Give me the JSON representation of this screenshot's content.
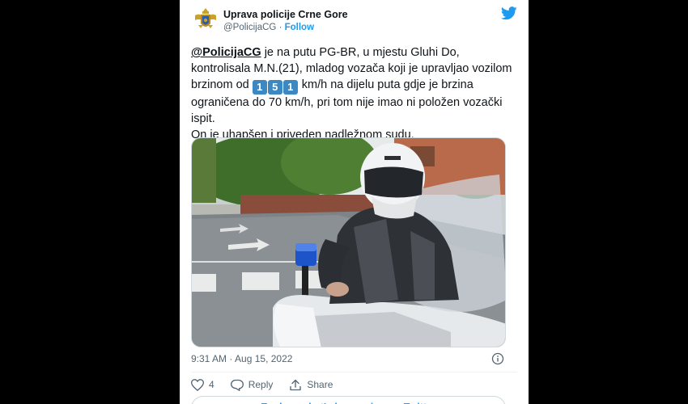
{
  "account": {
    "name": "Uprava policije Crne Gore",
    "handle": "@PolicijaCG",
    "separator": "·",
    "follow_label": "Follow"
  },
  "tweet": {
    "mention": "@PolicijaCG",
    "text_part1": " je na putu PG-BR, u mjestu Gluhi Do, kontrolisala M.N.(21), mladog vozača koji je upravljao vozilom brzinom od ",
    "speed_digits": [
      "1",
      "5",
      "1"
    ],
    "text_part2": " km/h na dijelu puta gdje je brzina ograničena do 70 km/h, pri tom nije imao ni položen vozački ispit.",
    "text_line2": "On je uhapšen i priveden nadležnom sudu."
  },
  "meta": {
    "timestamp": "9:31 AM · Aug 15, 2022"
  },
  "actions": {
    "like_count": "4",
    "reply_label": "Reply",
    "share_label": "Share"
  },
  "footer": {
    "read_more_label": "Explore what's happening on Twitter"
  },
  "colors": {
    "twitter_blue": "#1d9bf0",
    "digit_box": "#3b88c3"
  },
  "icons": [
    "twitter-bird-icon",
    "coat-of-arms-icon",
    "info-icon",
    "heart-icon",
    "reply-icon",
    "share-icon"
  ]
}
